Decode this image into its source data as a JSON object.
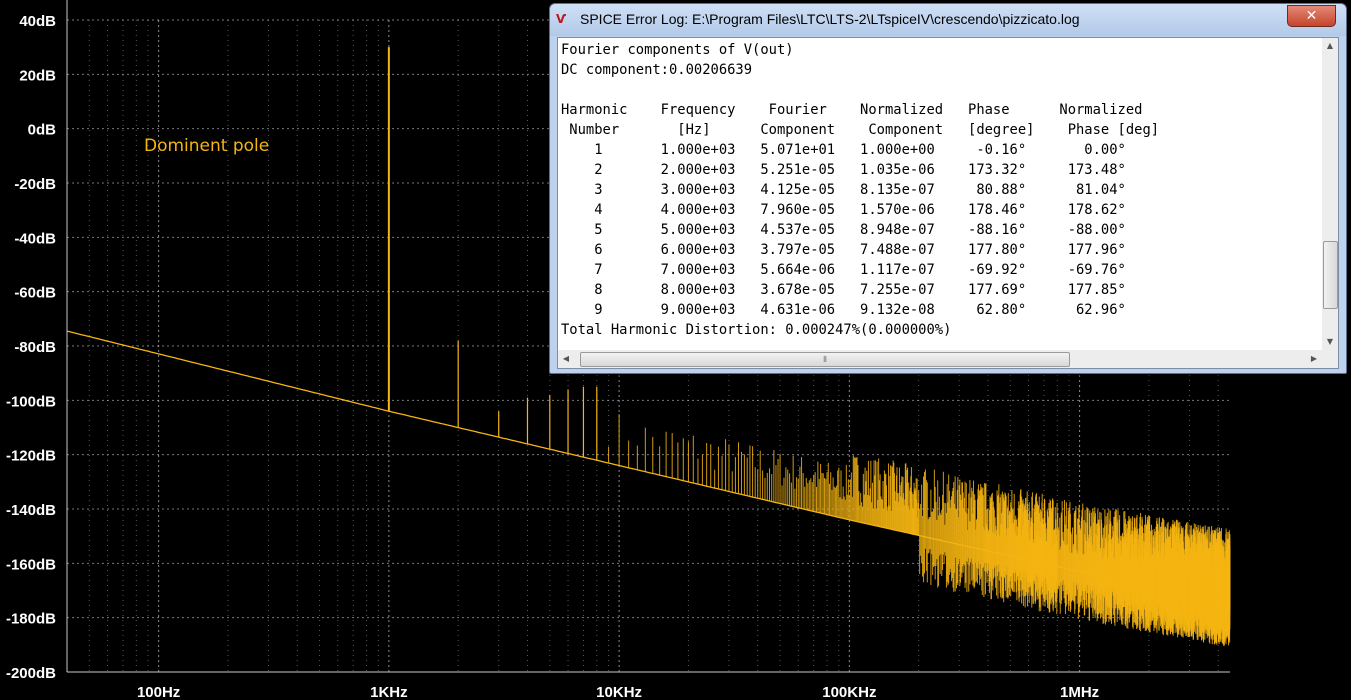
{
  "plot": {
    "colors": {
      "background": "#000000",
      "grid": "#c8c8c8",
      "trace": "#f5b512",
      "label": "#ffffff"
    },
    "x_axis": {
      "scale": "log",
      "min_hz": 40,
      "max_hz": 4500000,
      "ticks": [
        {
          "value": 100,
          "label": "100Hz"
        },
        {
          "value": 1000,
          "label": "1KHz"
        },
        {
          "value": 10000,
          "label": "10KHz"
        },
        {
          "value": 100000,
          "label": "100KHz"
        },
        {
          "value": 1000000,
          "label": "1MHz"
        }
      ]
    },
    "y_axis": {
      "min": -200,
      "max": 40,
      "ticks": [
        {
          "value": 40,
          "label": "40dB"
        },
        {
          "value": 20,
          "label": "20dB"
        },
        {
          "value": 0,
          "label": "0dB"
        },
        {
          "value": -20,
          "label": "-20dB"
        },
        {
          "value": -40,
          "label": "-40dB"
        },
        {
          "value": -60,
          "label": "-60dB"
        },
        {
          "value": -80,
          "label": "-80dB"
        },
        {
          "value": -100,
          "label": "-100dB"
        },
        {
          "value": -120,
          "label": "-120dB"
        },
        {
          "value": -140,
          "label": "-140dB"
        },
        {
          "value": -160,
          "label": "-160dB"
        },
        {
          "value": -180,
          "label": "-180dB"
        },
        {
          "value": -200,
          "label": "-200dB"
        }
      ]
    },
    "spectrum": {
      "floor": [
        {
          "hz": 40,
          "db": -74.5
        },
        {
          "hz": 1000,
          "db": -104
        },
        {
          "hz": 100000,
          "db": -144
        },
        {
          "hz": 1000000,
          "db": -163
        },
        {
          "hz": 4500000,
          "db": -173
        }
      ],
      "harmonics_db": [
        30,
        -78,
        -104,
        -99,
        -98,
        -96,
        -95,
        -95
      ]
    },
    "annotation": "Dominent pole"
  },
  "log_window": {
    "title": "SPICE Error Log: E:\\Program Files\\LTC\\LTS-2\\LTspiceIV\\crescendo\\pizzicato.log",
    "close_label": "✕",
    "icon_glyph": "Ѵ",
    "lines": [
      "Fourier components of V(out)",
      "DC component:0.00206639",
      "",
      "Harmonic    Frequency    Fourier    Normalized   Phase      Normalized",
      " Number       [Hz]      Component    Component   [degree]    Phase [deg]",
      "    1       1.000e+03   5.071e+01   1.000e+00     -0.16°       0.00°",
      "    2       2.000e+03   5.251e-05   1.035e-06    173.32°     173.48°",
      "    3       3.000e+03   4.125e-05   8.135e-07     80.88°      81.04°",
      "    4       4.000e+03   7.960e-05   1.570e-06    178.46°     178.62°",
      "    5       5.000e+03   4.537e-05   8.948e-07    -88.16°     -88.00°",
      "    6       6.000e+03   3.797e-05   7.488e-07    177.80°     177.96°",
      "    7       7.000e+03   5.664e-06   1.117e-07    -69.92°     -69.76°",
      "    8       8.000e+03   3.678e-05   7.255e-07    177.69°     177.85°",
      "    9       9.000e+03   4.631e-06   9.132e-08     62.80°      62.96°",
      "Total Harmonic Distortion: 0.000247%(0.000000%)"
    ]
  }
}
